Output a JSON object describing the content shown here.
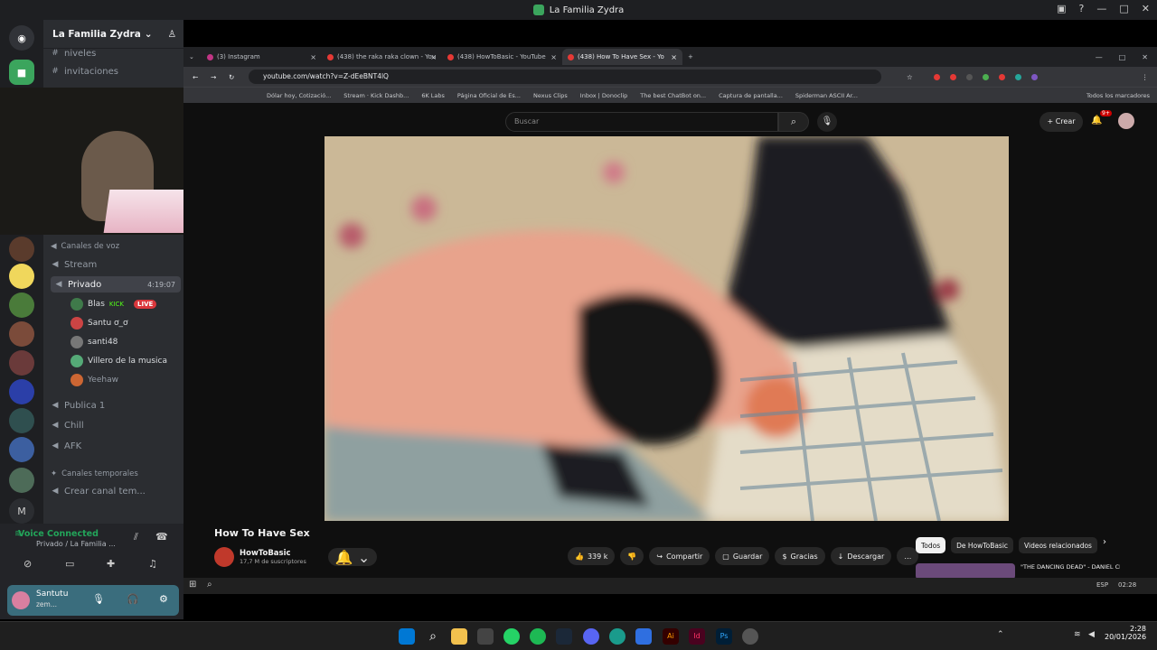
{
  "window": {
    "title": "La Familia Zydra"
  },
  "server": {
    "name": "La Familia Zydra"
  },
  "channels": {
    "top": [
      "niveles",
      "invitaciones"
    ],
    "voice_category": "Canales de voz",
    "voice": [
      "Stream",
      "Privado",
      "Publica 1",
      "Chill",
      "AFK"
    ],
    "privado_timer": "4:19:07",
    "temp_category": "Canales temporales",
    "temp_item": "Crear canal tem..."
  },
  "voice_users": [
    {
      "name": "Blas",
      "tag": "KICK",
      "live": "LIVE"
    },
    {
      "name": "Santu ơ_ơ"
    },
    {
      "name": "santi48"
    },
    {
      "name": "Villero de la musica"
    },
    {
      "name": "Yeehaw"
    }
  ],
  "voice_panel": {
    "status": "Voice Connected",
    "channel": "Privado / La Familia ..."
  },
  "user": {
    "name": "Santutu",
    "status": "zem..."
  },
  "browser": {
    "tabs": [
      "(3) Instagram",
      "(438) the raka raka clown - You",
      "(438) HowToBasic - YouTube",
      "(438) How To Have Sex - Yo"
    ],
    "url": "youtube.com/watch?v=Z-dEeBNT4lQ",
    "bookmarks": [
      "Dólar hoy, Cotizació...",
      "Stream · Kick Dashb...",
      "6K Labs",
      "Página Oficial de Es...",
      "Nexus Clips",
      "Inbox | Donoclip",
      "The best ChatBot on...",
      "Captura de pantalla...",
      "Spiderman ASCII Ar..."
    ],
    "all_bookmarks": "Todos los marcadores"
  },
  "youtube": {
    "search_placeholder": "Buscar",
    "create_label": "Crear",
    "notif_count": "9+",
    "video_title": "How To Have Sex",
    "channel_name": "HowToBasic",
    "subscribers": "17,7 M de suscriptores",
    "likes": "339 k",
    "share": "Compartir",
    "save": "Guardar",
    "thanks": "Gracias",
    "download": "Descargar",
    "filters": [
      "Todos",
      "De HowToBasic",
      "Videos relacionados"
    ],
    "suggest_title": "\"THE DANCING DEAD\" - DANIEL CLOUD CAMPOS"
  },
  "taskbar": {
    "time": "2:28",
    "date": "20/01/2026",
    "lang": "ESP",
    "inner_time": "02:28"
  }
}
